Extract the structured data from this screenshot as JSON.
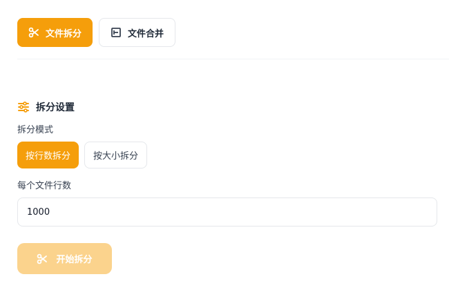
{
  "tabs": [
    {
      "label": "文件拆分",
      "icon": "scissors-icon",
      "active": true
    },
    {
      "label": "文件合并",
      "icon": "merge-icon",
      "active": false
    }
  ],
  "section": {
    "title": "拆分设置",
    "icon": "sliders-icon"
  },
  "split_mode": {
    "label": "拆分模式",
    "options": [
      {
        "label": "按行数拆分",
        "selected": true
      },
      {
        "label": "按大小拆分",
        "selected": false
      }
    ]
  },
  "lines_per_file": {
    "label": "每个文件行数",
    "value": "1000"
  },
  "start_button": {
    "label": "开始拆分",
    "icon": "scissors-icon"
  },
  "colors": {
    "accent": "#f59e0b",
    "accent_disabled": "#fbd38d",
    "border": "#e5e7eb"
  }
}
